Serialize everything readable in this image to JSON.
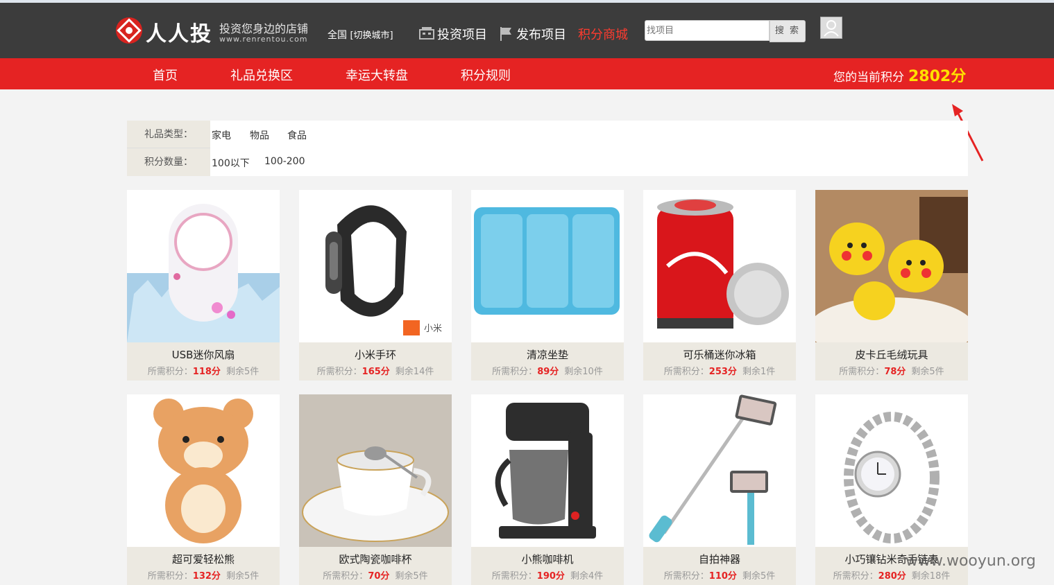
{
  "header": {
    "logo_text": "人人投",
    "slogan": "投资您身边的店铺",
    "url": "www.renrentou.com",
    "city": "全国",
    "city_switch": "[切换城市]",
    "nav": [
      {
        "label": "投资项目",
        "icon": "building-icon"
      },
      {
        "label": "发布项目",
        "icon": "flag-icon"
      },
      {
        "label": "积分商城",
        "active": true
      }
    ],
    "search_placeholder": "找项目",
    "search_button": "搜 索"
  },
  "menu": {
    "items": [
      "首页",
      "礼品兑换区",
      "幸运大转盘",
      "积分规则"
    ],
    "points_label": "您的当前积分",
    "points_value": "2802分"
  },
  "filters": {
    "type_label": "礼品类型：",
    "type_options": [
      "家电",
      "物品",
      "食品"
    ],
    "points_label": "积分数量：",
    "points_options": [
      "100以下",
      "100-200"
    ]
  },
  "products": [
    {
      "name": "USB迷你风扇",
      "points": "118分",
      "stock": "剩余5件"
    },
    {
      "name": "小米手环",
      "points": "165分",
      "stock": "剩余14件"
    },
    {
      "name": "清凉坐垫",
      "points": "89分",
      "stock": "剩余10件"
    },
    {
      "name": "可乐桶迷你冰箱",
      "points": "253分",
      "stock": "剩余1件"
    },
    {
      "name": "皮卡丘毛绒玩具",
      "points": "78分",
      "stock": "剩余5件"
    },
    {
      "name": "超可爱轻松熊",
      "points": "132分",
      "stock": "剩余5件"
    },
    {
      "name": "欧式陶瓷咖啡杯",
      "points": "70分",
      "stock": "剩余5件"
    },
    {
      "name": "小熊咖啡机",
      "points": "190分",
      "stock": "剩余4件"
    },
    {
      "name": "自拍神器",
      "points": "110分",
      "stock": "剩余5件"
    },
    {
      "name": "小巧镶钻米奇手链表",
      "points": "280分",
      "stock": "剩余18件"
    }
  ],
  "points_required_label": "所需积分：",
  "watermark": "www.wooyun.org",
  "colors": {
    "header_bg": "#3c3c3c",
    "accent_red": "#e52323",
    "points_yellow": "#ffe000",
    "active_nav": "#ff3b2f"
  }
}
